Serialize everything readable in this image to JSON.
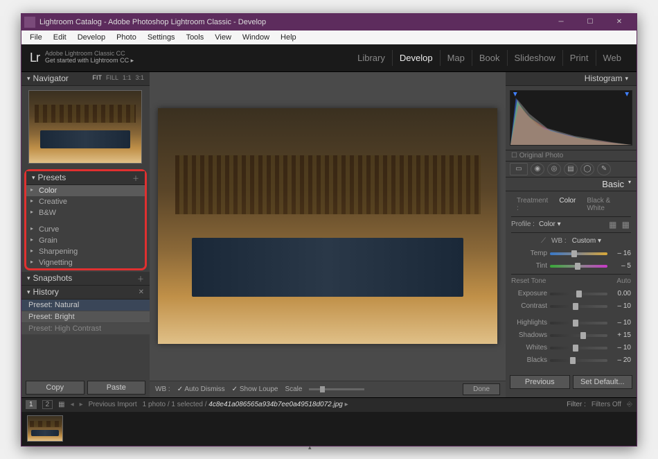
{
  "window": {
    "title": "Lightroom Catalog - Adobe Photoshop Lightroom Classic - Develop"
  },
  "menubar": [
    "File",
    "Edit",
    "Develop",
    "Photo",
    "Settings",
    "Tools",
    "View",
    "Window",
    "Help"
  ],
  "logo": {
    "brand": "Lr",
    "line1": "Adobe Lightroom Classic CC",
    "line2": "Get started with Lightroom CC ▸"
  },
  "modules": [
    "Library",
    "Develop",
    "Map",
    "Book",
    "Slideshow",
    "Print",
    "Web"
  ],
  "active_module": "Develop",
  "navigator": {
    "label": "Navigator",
    "modes": [
      "FIT",
      "FILL",
      "1:1",
      "3:1"
    ],
    "active_mode": "FIT"
  },
  "presets": {
    "label": "Presets",
    "groups_top": [
      "Color",
      "Creative",
      "B&W"
    ],
    "groups_bottom": [
      "Curve",
      "Grain",
      "Sharpening",
      "Vignetting"
    ],
    "selected": "Color"
  },
  "snapshots": {
    "label": "Snapshots"
  },
  "history": {
    "label": "History",
    "items": [
      "Preset: Natural",
      "Preset: Bright",
      "Preset: High Contrast"
    ],
    "selected": "Preset: Natural"
  },
  "left_buttons": {
    "copy": "Copy",
    "paste": "Paste"
  },
  "center_toolbar": {
    "wb_label": "WB :",
    "auto_dismiss": "Auto Dismiss",
    "show_loupe": "Show Loupe",
    "scale": "Scale",
    "done": "Done"
  },
  "histogram": {
    "label": "Histogram",
    "original": "Original Photo"
  },
  "basic": {
    "label": "Basic",
    "treatment_label": "Treatment :",
    "treatment_color": "Color",
    "treatment_bw": "Black & White",
    "profile_label": "Profile :",
    "profile_value": "Color",
    "wb_label": "WB :",
    "wb_value": "Custom",
    "sliders_wb": [
      {
        "name": "Temp",
        "value": "– 16",
        "pos": 42,
        "track": "temp"
      },
      {
        "name": "Tint",
        "value": "– 5",
        "pos": 48,
        "track": "tint"
      }
    ],
    "tone_reset": "Reset Tone",
    "tone_auto": "Auto",
    "sliders_tone": [
      {
        "name": "Exposure",
        "value": "0.00",
        "pos": 50
      },
      {
        "name": "Contrast",
        "value": "– 10",
        "pos": 45
      },
      {
        "name": "Highlights",
        "value": "– 10",
        "pos": 45
      },
      {
        "name": "Shadows",
        "value": "+ 15",
        "pos": 58
      },
      {
        "name": "Whites",
        "value": "– 10",
        "pos": 45
      },
      {
        "name": "Blacks",
        "value": "– 20",
        "pos": 40
      }
    ]
  },
  "right_buttons": {
    "previous": "Previous",
    "set_default": "Set Default..."
  },
  "filmstrip": {
    "grid_nums": [
      "1",
      "2"
    ],
    "prev_import": "Previous Import",
    "count": "1 photo / 1 selected /",
    "filename": "4c8e41a086565a934b7ee0a49518d072.jpg",
    "filter_label": "Filter :",
    "filter_value": "Filters Off"
  }
}
